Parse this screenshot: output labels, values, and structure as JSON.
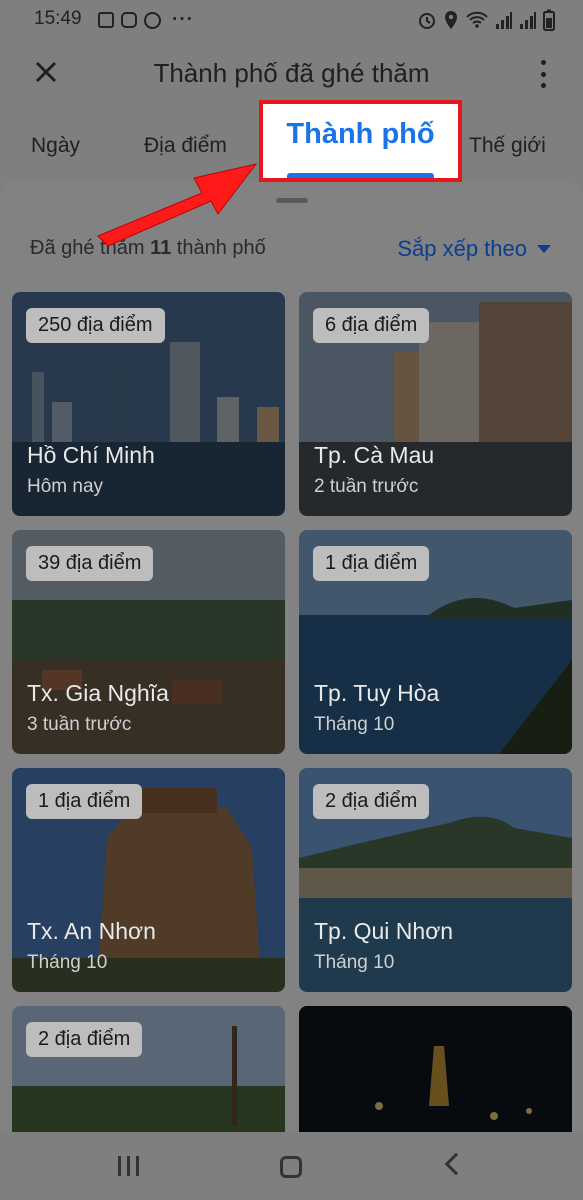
{
  "status_bar": {
    "time": "15:49",
    "left_icons": [
      "gallery-icon",
      "instagram-icon",
      "circle-app-icon",
      "more-dots-icon"
    ],
    "right_icons": [
      "alarm-icon",
      "location-icon",
      "wifi-icon",
      "signal-icon",
      "signal-icon",
      "battery-icon"
    ]
  },
  "app_bar": {
    "title": "Thành phố đã ghé thăm",
    "close_icon": "close-icon",
    "more_icon": "more-vert-icon"
  },
  "tabs": [
    {
      "label": "Ngày",
      "selected": false
    },
    {
      "label": "Địa điểm",
      "selected": false
    },
    {
      "label": "Thành phố",
      "selected": true
    },
    {
      "label": "Thế giới",
      "selected": false
    }
  ],
  "sheet": {
    "count_prefix": "Đã ghé thăm",
    "count_value": "11",
    "count_suffix": "thành phố",
    "sort_label": "Sắp xếp theo"
  },
  "cities": [
    {
      "badge": "250 địa điểm",
      "name": "Hồ Chí Minh",
      "time": "Hôm nay"
    },
    {
      "badge": "6 địa điểm",
      "name": "Tp. Cà Mau",
      "time": "2 tuần trước"
    },
    {
      "badge": "39 địa điểm",
      "name": "Tx. Gia Nghĩa",
      "time": "3 tuần trước"
    },
    {
      "badge": "1 địa điểm",
      "name": "Tp. Tuy Hòa",
      "time": "Tháng 10"
    },
    {
      "badge": "1 địa điểm",
      "name": "Tx. An Nhơn",
      "time": "Tháng 10"
    },
    {
      "badge": "2 địa điểm",
      "name": "Tp. Qui Nhơn",
      "time": "Tháng 10"
    },
    {
      "badge": "2 địa điểm",
      "name": "",
      "time": ""
    },
    {
      "badge": "",
      "name": "",
      "time": ""
    }
  ],
  "colors": {
    "accent": "#1a73e8",
    "highlight_border": "#e5161c",
    "arrow": "#ff1a1a",
    "dim_overlay": "#7f7f7f"
  }
}
